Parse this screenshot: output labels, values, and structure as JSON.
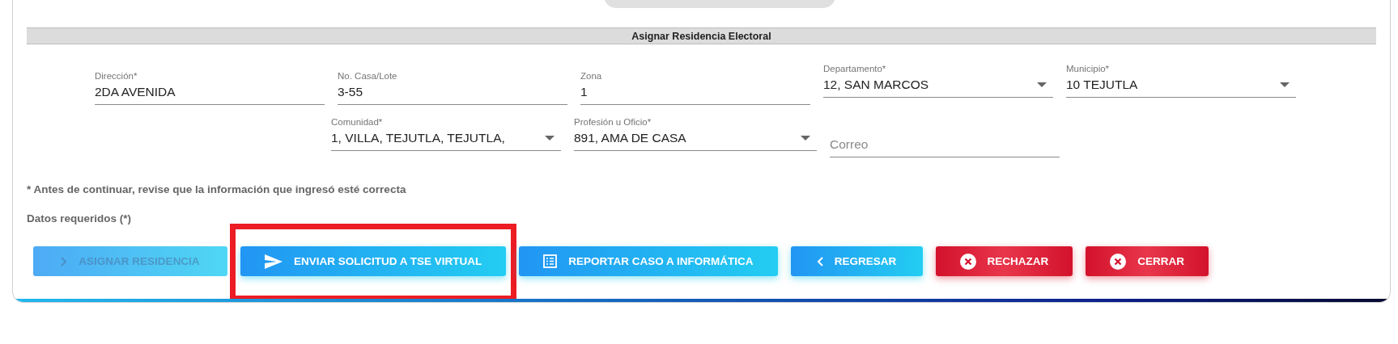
{
  "section": {
    "title": "Asignar Residencia Electoral"
  },
  "field_rows": [
    {
      "fields": [
        {
          "kind": "text",
          "label": "Dirección*",
          "value": "2DA AVENIDA"
        },
        {
          "kind": "text",
          "label": "No. Casa/Lote",
          "value": "3-55"
        },
        {
          "kind": "text",
          "label": "Zona",
          "value": "1"
        },
        {
          "kind": "select",
          "label": "Departamento*",
          "value": "12, SAN MARCOS"
        },
        {
          "kind": "select",
          "label": "Municipio*",
          "value": "10 TEJUTLA"
        }
      ]
    },
    {
      "fields": [
        {
          "kind": "select",
          "label": "Comunidad*",
          "value": "1, VILLA, TEJUTLA, TEJUTLA,"
        },
        {
          "kind": "select",
          "label": "Profesión u Oficio*",
          "value": "891, AMA DE CASA"
        },
        {
          "kind": "text",
          "placeholder": "Correo"
        }
      ]
    }
  ],
  "notice": "* Antes de continuar, revise que la información que ingresó esté correcta",
  "required_note": "Datos requeridos (*)",
  "buttons": [
    {
      "label": "ASIGNAR RESIDENCIA",
      "kind": "action",
      "disabled": true,
      "highlighted": false
    },
    {
      "label": "ENVIAR SOLICITUD A TSE VIRTUAL",
      "kind": "action",
      "disabled": false,
      "highlighted": true
    },
    {
      "label": "REPORTAR CASO A INFORMÁTICA",
      "kind": "action",
      "disabled": false,
      "highlighted": false
    },
    {
      "label": "REGRESAR",
      "kind": "action",
      "disabled": false,
      "highlighted": false
    },
    {
      "label": "RECHAZAR",
      "kind": "danger",
      "disabled": false,
      "highlighted": false
    },
    {
      "label": "CERRAR",
      "kind": "danger",
      "disabled": false,
      "highlighted": false
    }
  ]
}
